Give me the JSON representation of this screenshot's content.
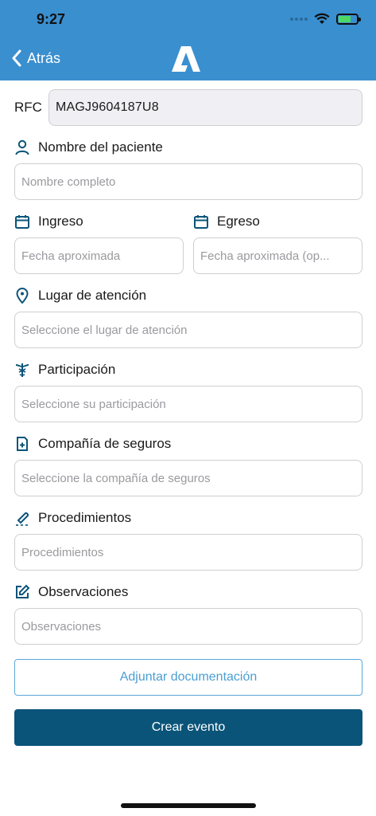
{
  "status_bar": {
    "time": "9:27"
  },
  "nav": {
    "back_label": "Atrás"
  },
  "rfc": {
    "label": "RFC",
    "value": "MAGJ9604187U8"
  },
  "patient": {
    "label": "Nombre del paciente",
    "placeholder": "Nombre completo"
  },
  "ingreso": {
    "label": "Ingreso",
    "placeholder": "Fecha aproximada"
  },
  "egreso": {
    "label": "Egreso",
    "placeholder": "Fecha aproximada (op..."
  },
  "location": {
    "label": "Lugar de atención",
    "placeholder": "Seleccione el lugar de atención"
  },
  "participation": {
    "label": "Participación",
    "placeholder": "Seleccione su participación"
  },
  "insurance": {
    "label": "Compañía de seguros",
    "placeholder": "Seleccione la compañía de seguros"
  },
  "procedures": {
    "label": "Procedimientos",
    "placeholder": "Procedimientos"
  },
  "observations": {
    "label": "Observaciones",
    "placeholder": "Observaciones"
  },
  "actions": {
    "attach_label": "Adjuntar documentación",
    "create_label": "Crear evento"
  },
  "colors": {
    "header": "#3a8fcf",
    "icon": "#0a5479",
    "primary_button": "#0a5479",
    "outline_button": "#4a9fd3"
  }
}
